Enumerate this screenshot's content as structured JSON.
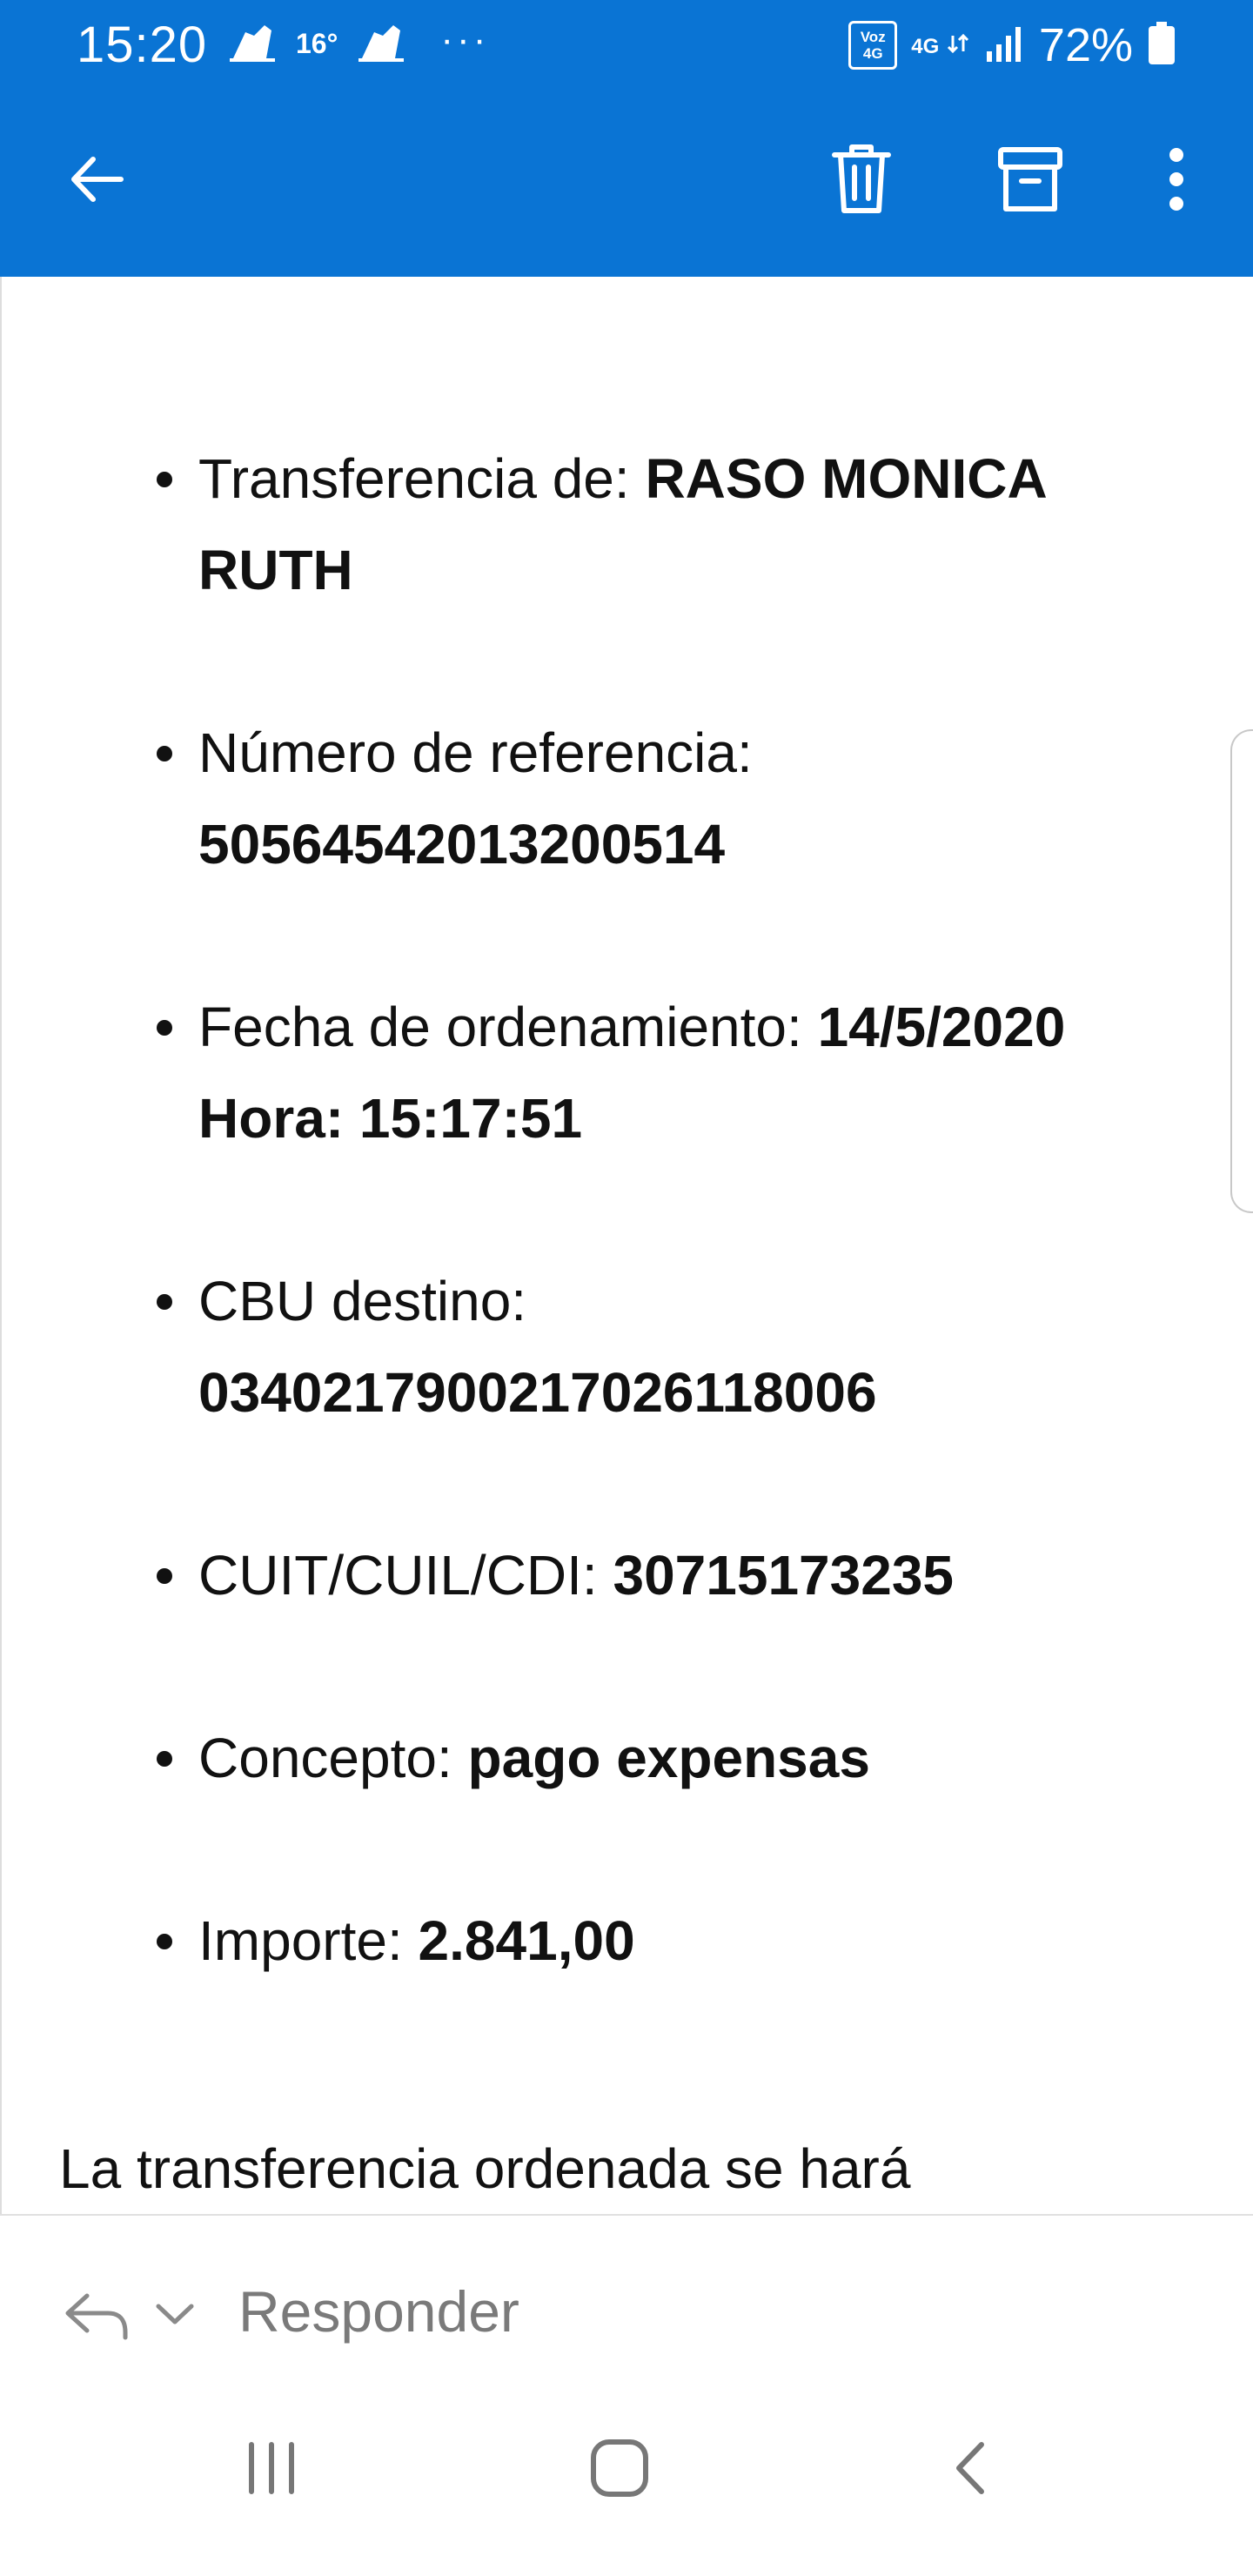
{
  "status_bar": {
    "time": "15:20",
    "temperature": "16°",
    "more_indicator": "···",
    "volte_top": "Voz",
    "volte_bottom": "4G",
    "network_type": "4G",
    "battery_percent": "72%",
    "icons": [
      "weather-icon",
      "weather-icon",
      "volte-icon",
      "data-arrows-icon",
      "signal-icon",
      "battery-icon"
    ]
  },
  "app_bar": {
    "icons": [
      "back-arrow-icon",
      "trash-icon",
      "archive-icon",
      "more-vert-icon"
    ],
    "background_color": "#0a74d4"
  },
  "email_body": {
    "items": [
      {
        "label": "Transferencia de: ",
        "value": "RASO MONICA RUTH"
      },
      {
        "label": "Número de referencia: ",
        "value": "50564542013200514"
      },
      {
        "label": "Fecha de ordenamiento: ",
        "value": "14/5/2020 Hora: 15:17:51"
      },
      {
        "label": "CBU destino: ",
        "value": "0340217900217026118006"
      },
      {
        "label": "CUIT/CUIL/CDI: ",
        "value": "30715173235"
      },
      {
        "label": "Concepto: ",
        "value": "pago expensas"
      },
      {
        "label": "Importe: ",
        "value": "2.841,00"
      }
    ],
    "trailing_text": "La transferencia ordenada se hará"
  },
  "reply_bar": {
    "label": "Responder",
    "icons": [
      "reply-icon",
      "chevron-down-icon"
    ]
  },
  "nav_bar": {
    "icons": [
      "recent-apps-icon",
      "home-icon",
      "back-icon"
    ]
  }
}
